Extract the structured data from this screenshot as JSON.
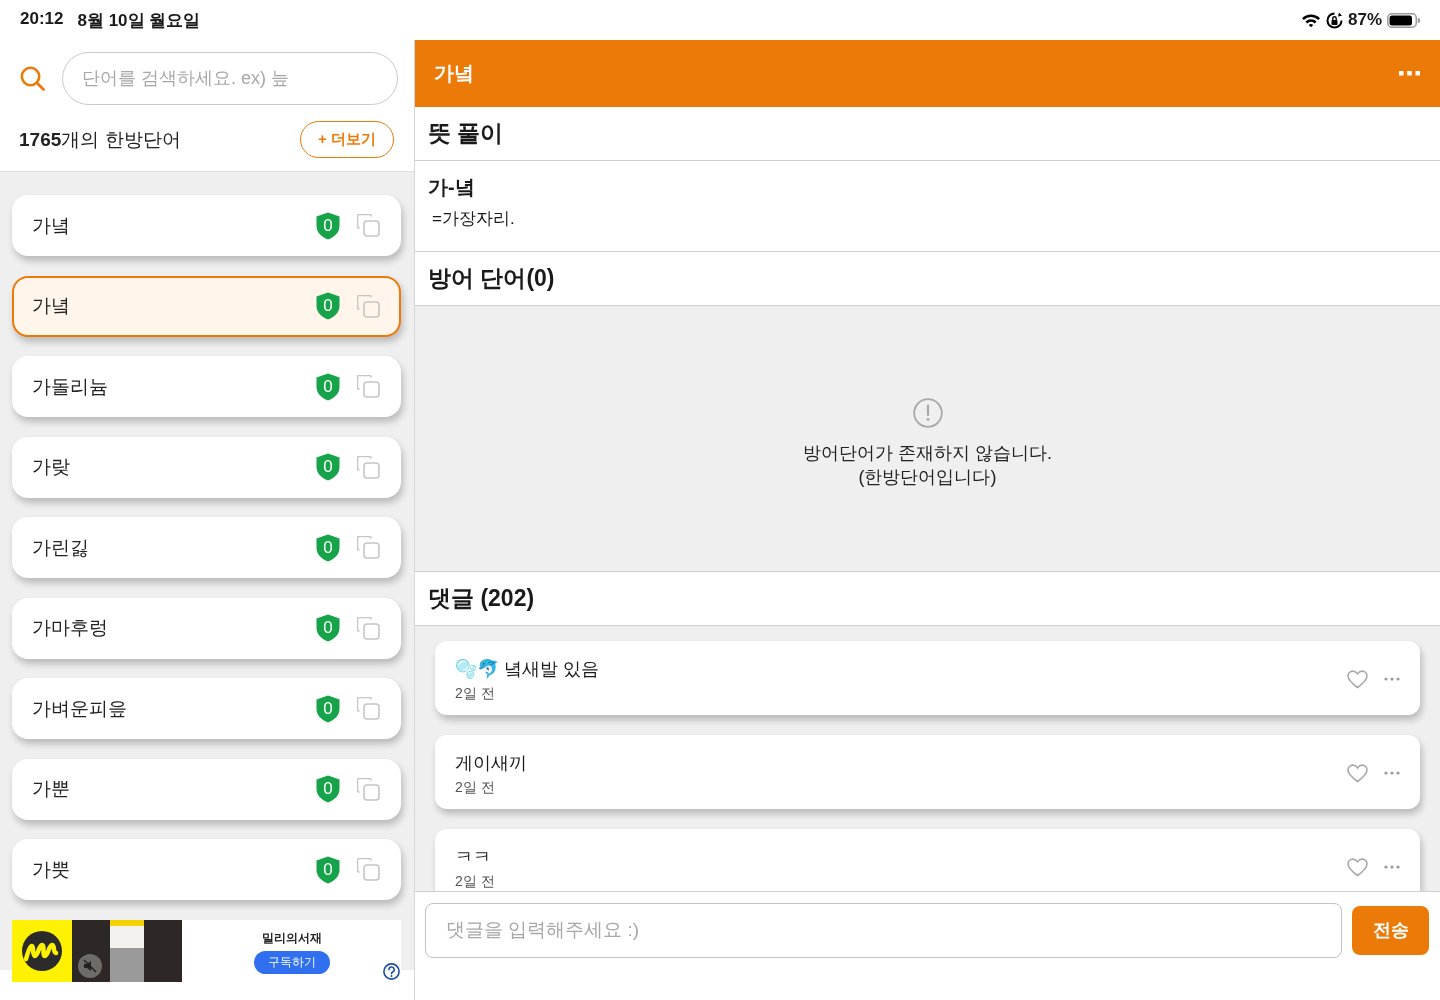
{
  "status_bar": {
    "time": "20:12",
    "date": "8월 10일 월요일",
    "battery": "87%"
  },
  "sidebar": {
    "search": {
      "placeholder": "단어를 검색하세요. ex) 늪"
    },
    "count": "**1765**개의 한방단어",
    "more_button": "+ 더보기",
    "words": [
      {
        "word": "가녘",
        "score": "0",
        "selected": false
      },
      {
        "word": "가녘",
        "score": "0",
        "selected": true
      },
      {
        "word": "가돌리늄",
        "score": "0",
        "selected": false
      },
      {
        "word": "가랒",
        "score": "0",
        "selected": false
      },
      {
        "word": "가린긿",
        "score": "0",
        "selected": false
      },
      {
        "word": "가마후렁",
        "score": "0",
        "selected": false
      },
      {
        "word": "가벼운피읖",
        "score": "0",
        "selected": false
      },
      {
        "word": "가뿐",
        "score": "0",
        "selected": false
      },
      {
        "word": "가뿟",
        "score": "0",
        "selected": false
      }
    ]
  },
  "ad": {
    "brand": "밀리의서재",
    "button": "구독하기"
  },
  "detail": {
    "title": "가녘",
    "meaning": {
      "heading": "뜻 풀이",
      "entry": "가-녘",
      "definition": "=가장자리."
    },
    "defense": {
      "heading": "방어 단어(0)",
      "empty_message": "방어단어가 존재하지 않습니다.\n(한방단어입니다)"
    },
    "comments": {
      "heading": "댓글 (202)",
      "items": [
        {
          "text": "🫧🐬 녘새발 있음",
          "time": "2일 전"
        },
        {
          "text": "게이새끼",
          "time": "2일 전"
        },
        {
          "text": "ㅋㅋ",
          "time": "2일 전"
        }
      ]
    },
    "comment_input": {
      "placeholder": "댓글을 입력해주세요 :)"
    },
    "send_button": "전송"
  }
}
